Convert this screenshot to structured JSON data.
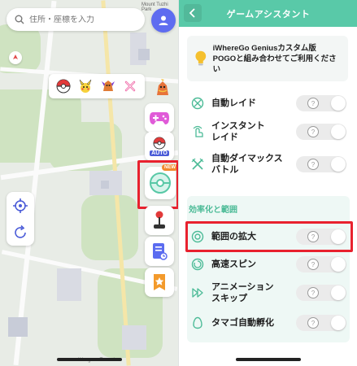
{
  "map": {
    "search_placeholder": "住所・座標を入力",
    "place_label_top": "Mount Tuzhi Park",
    "place_label_bottom": "Wangsan Tunnel",
    "auto_label": "AUTO",
    "new_badge": "NEW",
    "icons": [
      "search-icon",
      "user-icon",
      "gamepad-icon",
      "pokeball-icon",
      "joystick-icon",
      "notes-icon",
      "star-icon",
      "crosshair-icon",
      "refresh-icon"
    ]
  },
  "assistant": {
    "title": "ゲームアシスタント",
    "info": {
      "line1": "iWhereGo Geniusカスタム版",
      "line2": "POGOと組み合わせてご利用ください"
    },
    "rows_top": [
      {
        "label": "自動レイド",
        "enabled": false
      },
      {
        "label": "インスタントレイド",
        "label_line1": "インスタント",
        "label_line2": "レイド",
        "enabled": false
      },
      {
        "label": "自動ダイマックスバトル",
        "label_line1": "自動ダイマックス",
        "label_line2": "バトル",
        "enabled": false
      }
    ],
    "section_title": "効率化と範囲",
    "rows_section": [
      {
        "label": "範囲の拡大",
        "enabled": false
      },
      {
        "label": "高速スピン",
        "enabled": false
      },
      {
        "label": "アニメーションスキップ",
        "label_line1": "アニメーション",
        "label_line2": "スキップ",
        "enabled": false
      },
      {
        "label": "タマゴ自動孵化",
        "enabled": false
      }
    ],
    "help_glyph": "?"
  },
  "colors": {
    "accent": "#59c9a8",
    "highlight": "#e8212e",
    "section_text": "#4cbb97"
  }
}
